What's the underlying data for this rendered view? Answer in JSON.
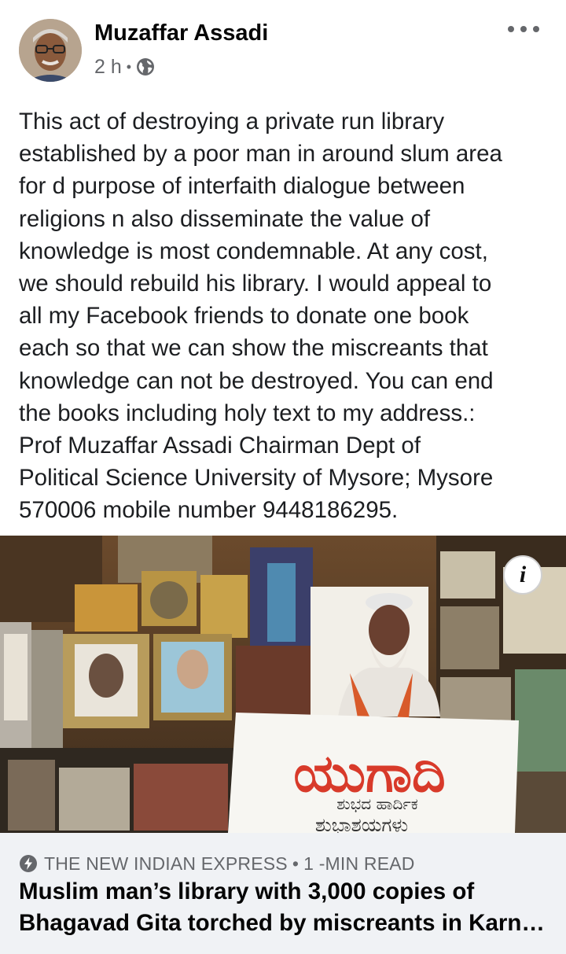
{
  "post": {
    "author": "Muzaffar Assadi",
    "time": "2 h",
    "privacy_icon": "globe-icon",
    "body": "This act of destroying a private run library\nestablished by a poor man in around slum area\nfor d purpose of interfaith dialogue between\nreligions n also disseminate the value of\nknowledge is most condemnable. At any cost,\nwe should rebuild his library. I would appeal to\nall my Facebook friends to donate one book\neach so that we can show the miscreants that\nknowledge can not be destroyed. You can end\nthe books including holy text to my address.:\nProf Muzaffar Assadi Chairman Dept of\nPolitical Science University of Mysore; Mysore\n570006 mobile number 9448186295."
  },
  "link": {
    "source": "THE NEW INDIAN EXPRESS",
    "read_time": "1 -MIN READ",
    "headline_line1": "Muslim man’s library with 3,000 copies of",
    "headline_line2": "Bhagavad Gita torched by miscreants in Karn…",
    "sign_text_main": "ಯುಗಾದಿ",
    "sign_text_sub": "ಶುಭದ ಹಾರ್ದಿಕ",
    "sign_text_sub2": "ಶುಭಾಶಯಗಳು"
  },
  "colors": {
    "text_primary": "#1c1e21",
    "text_secondary": "#65676b",
    "footer_bg": "#f0f2f5",
    "sign_red": "#d83a2a"
  }
}
